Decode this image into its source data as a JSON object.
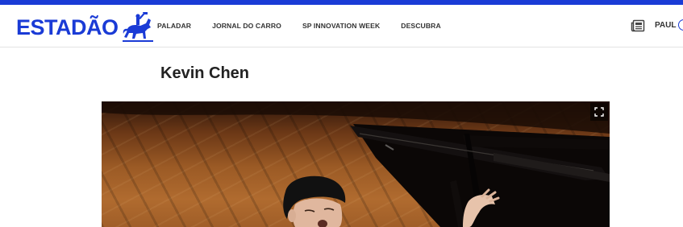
{
  "header": {
    "logo_text": "ESTADÃO",
    "nav": [
      {
        "label": "PALADAR"
      },
      {
        "label": "JORNAL DO CARRO"
      },
      {
        "label": "SP INNOVATION WEEK"
      },
      {
        "label": "DESCUBRA"
      }
    ],
    "user_label": "PAUL"
  },
  "article": {
    "title": "Kevin Chen"
  },
  "colors": {
    "brand_blue": "#1a3bd6"
  },
  "icons": {
    "logo": "horse-rider-logo-icon",
    "newspaper": "newspaper-icon",
    "expand": "expand-icon",
    "user": "user-avatar-icon"
  }
}
